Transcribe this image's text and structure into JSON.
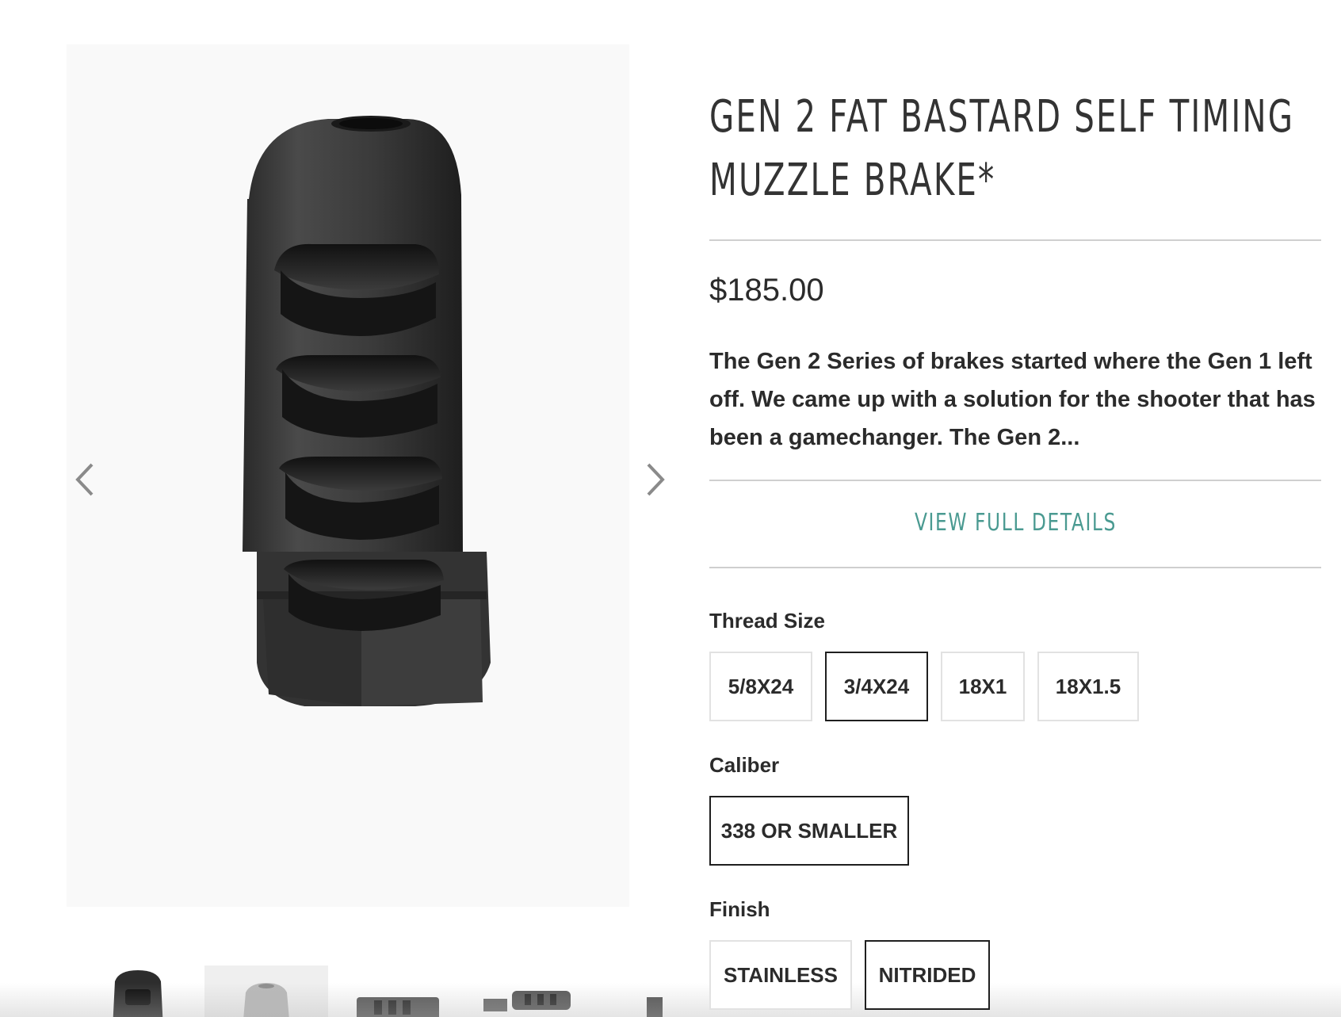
{
  "product": {
    "title": "GEN 2 FAT BASTARD SELF TIMING MUZZLE BRAKE*",
    "price": "$185.00",
    "description": "The Gen 2 Series of brakes started where the Gen 1 left off.  We came up with a solution for the shooter that has been a gamechanger.  The Gen 2...",
    "view_details_label": "VIEW FULL DETAILS"
  },
  "options": {
    "thread_size": {
      "label": "Thread Size",
      "values": [
        "5/8X24",
        "3/4X24",
        "18X1",
        "18X1.5"
      ],
      "selected": "3/4X24"
    },
    "caliber": {
      "label": "Caliber",
      "values": [
        "338 OR SMALLER"
      ],
      "selected": "338 OR SMALLER"
    },
    "finish": {
      "label": "Finish",
      "values": [
        "STAINLESS",
        "NITRIDED"
      ],
      "selected": "NITRIDED"
    }
  },
  "gallery": {
    "prev_icon": "chevron-left-icon",
    "next_icon": "chevron-right-icon",
    "thumbnail_count": 5
  },
  "colors": {
    "accent": "#4a9a91",
    "selected_border": "#1f1f1f",
    "option_border": "#e2e2e2"
  }
}
